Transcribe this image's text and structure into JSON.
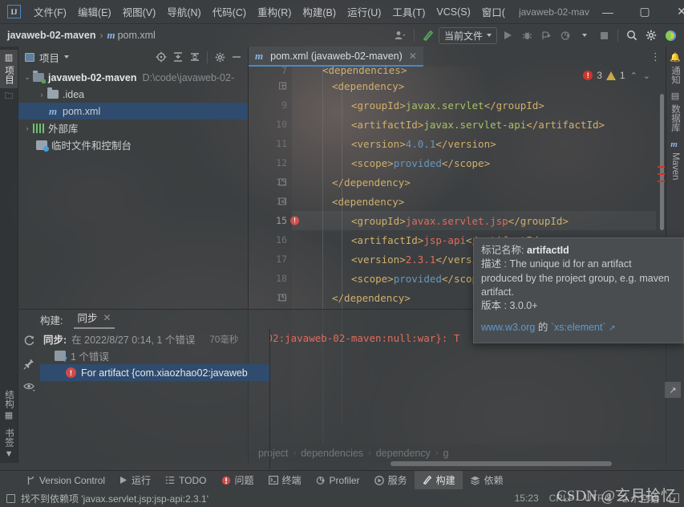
{
  "window": {
    "logo": "IJ",
    "title": "javaweb-02-mav",
    "minimize": "—",
    "maximize": "▢",
    "close": "✕"
  },
  "menu": [
    {
      "label": "文件(F)",
      "name": "menu-file"
    },
    {
      "label": "编辑(E)",
      "name": "menu-edit"
    },
    {
      "label": "视图(V)",
      "name": "menu-view"
    },
    {
      "label": "导航(N)",
      "name": "menu-navigate"
    },
    {
      "label": "代码(C)",
      "name": "menu-code"
    },
    {
      "label": "重构(R)",
      "name": "menu-refactor"
    },
    {
      "label": "构建(B)",
      "name": "menu-build"
    },
    {
      "label": "运行(U)",
      "name": "menu-run"
    },
    {
      "label": "工具(T)",
      "name": "menu-tools"
    },
    {
      "label": "VCS(S)",
      "name": "menu-vcs"
    },
    {
      "label": "窗口(",
      "name": "menu-window"
    }
  ],
  "navbar": {
    "project": "javaweb-02-maven",
    "separator": "›",
    "file_badge": "m",
    "file": "pom.xml",
    "run_config": "当前文件",
    "icons": {
      "profile": "profile-icon",
      "hammer": "build-hammer-icon",
      "run": "▶",
      "debug": "debug-icon",
      "run_coverage": "coverage-icon",
      "profiler": "profiler-icon",
      "stop": "■",
      "search": "search-icon",
      "settings": "gear-icon",
      "updates": "updates-icon"
    }
  },
  "left_strip": [
    {
      "label": "项目",
      "icon": "project-icon",
      "active": true,
      "name": "strip-project"
    },
    {
      "label": "",
      "icon": "folder-icon",
      "active": false,
      "name": "strip-commit"
    },
    {
      "label": "结构",
      "icon": "structure-icon",
      "active": false,
      "name": "strip-structure"
    },
    {
      "label": "书签",
      "icon": "bookmark-icon",
      "active": false,
      "name": "strip-bookmarks"
    }
  ],
  "right_strip": [
    {
      "label": "通知",
      "icon": "bell-icon",
      "name": "strip-notifications"
    },
    {
      "label": "数据库",
      "icon": "database-icon",
      "name": "strip-database"
    },
    {
      "label": "Maven",
      "icon": "maven-icon",
      "name": "strip-maven"
    }
  ],
  "project_panel": {
    "title": "项目",
    "dropdown_caret": "▾",
    "toolbar_icons": [
      "locate-icon",
      "expand-all-icon",
      "collapse-all-icon",
      "gear-icon",
      "hide-icon"
    ],
    "tree": [
      {
        "indent": 0,
        "twisty": "⌄",
        "icon": "module-folder-icon",
        "label": "javaweb-02-maven",
        "bold": true,
        "path": "D:\\code\\javaweb-02-",
        "selected": false
      },
      {
        "indent": 1,
        "twisty": "›",
        "icon": "folder-icon",
        "label": ".idea",
        "bold": false,
        "path": "",
        "selected": false
      },
      {
        "indent": 2,
        "twisty": "",
        "icon": "maven-file-icon",
        "label": "pom.xml",
        "bold": false,
        "path": "",
        "selected": true
      },
      {
        "indent": 0,
        "twisty": "›",
        "icon": "library-icon",
        "label": "外部库",
        "bold": false,
        "path": "",
        "selected": false
      },
      {
        "indent": 1,
        "twisty": "",
        "icon": "scratches-icon",
        "label": "临时文件和控制台",
        "bold": false,
        "path": "",
        "selected": false
      }
    ]
  },
  "editor": {
    "tab": {
      "badge": "m",
      "label": "pom.xml (javaweb-02-maven)",
      "close": "✕"
    },
    "overflow": "⋮",
    "inspections": {
      "error_count": "3",
      "error_glyph": "!",
      "warning_count": "1",
      "prev": "⌃",
      "next": "⌄"
    },
    "lines": [
      {
        "num": "7",
        "fold": "",
        "marker": "",
        "indent": 3,
        "tokens": [
          {
            "t": "tag",
            "v": "<dependencies>"
          }
        ],
        "current": false,
        "clipped": true
      },
      {
        "num": "8",
        "fold": "−",
        "marker": "",
        "indent": 4,
        "tokens": [
          {
            "t": "tag",
            "v": "<dependency>"
          }
        ],
        "current": false
      },
      {
        "num": "9",
        "fold": "",
        "marker": "",
        "indent": 6,
        "tokens": [
          {
            "t": "tag",
            "v": "<groupId>"
          },
          {
            "t": "val",
            "v": "javax.servlet"
          },
          {
            "t": "tag",
            "v": "</groupId>"
          }
        ],
        "current": false
      },
      {
        "num": "10",
        "fold": "",
        "marker": "",
        "indent": 6,
        "tokens": [
          {
            "t": "tag",
            "v": "<artifactId>"
          },
          {
            "t": "val",
            "v": "javax.servlet-api"
          },
          {
            "t": "tag",
            "v": "</artifactId>"
          }
        ],
        "current": false
      },
      {
        "num": "11",
        "fold": "",
        "marker": "",
        "indent": 6,
        "tokens": [
          {
            "t": "tag",
            "v": "<version>"
          },
          {
            "t": "num",
            "v": "4.0.1"
          },
          {
            "t": "tag",
            "v": "</version>"
          }
        ],
        "current": false
      },
      {
        "num": "12",
        "fold": "",
        "marker": "",
        "indent": 6,
        "tokens": [
          {
            "t": "tag",
            "v": "<scope>"
          },
          {
            "t": "num",
            "v": "provided"
          },
          {
            "t": "tag",
            "v": "</scope>"
          }
        ],
        "current": false
      },
      {
        "num": "13",
        "fold": "⌃",
        "marker": "",
        "indent": 4,
        "tokens": [
          {
            "t": "tag",
            "v": "</dependency>"
          }
        ],
        "current": false
      },
      {
        "num": "14",
        "fold": "−",
        "marker": "",
        "indent": 4,
        "tokens": [
          {
            "t": "tag",
            "v": "<dependency>"
          }
        ],
        "current": false
      },
      {
        "num": "15",
        "fold": "",
        "marker": "error",
        "indent": 6,
        "tokens": [
          {
            "t": "tag",
            "v": "<groupId>"
          },
          {
            "t": "err",
            "v": "javax.servlet.jsp"
          },
          {
            "t": "tag",
            "v": "</groupId>"
          }
        ],
        "current": true
      },
      {
        "num": "16",
        "fold": "",
        "marker": "",
        "indent": 6,
        "tokens": [
          {
            "t": "tag",
            "v": "<artifactId>"
          },
          {
            "t": "err",
            "v": "jsp-api"
          },
          {
            "t": "tag",
            "v": "</artifactId>"
          }
        ],
        "current": false
      },
      {
        "num": "17",
        "fold": "",
        "marker": "",
        "indent": 6,
        "tokens": [
          {
            "t": "tag",
            "v": "<version>"
          },
          {
            "t": "err",
            "v": "2.3.1"
          },
          {
            "t": "tag",
            "v": "</versi"
          }
        ],
        "current": false
      },
      {
        "num": "18",
        "fold": "",
        "marker": "",
        "indent": 6,
        "tokens": [
          {
            "t": "tag",
            "v": "<scope>"
          },
          {
            "t": "num",
            "v": "provided"
          },
          {
            "t": "tag",
            "v": "</scop"
          }
        ],
        "current": false
      },
      {
        "num": "19",
        "fold": "⌃",
        "marker": "",
        "indent": 4,
        "tokens": [
          {
            "t": "tag",
            "v": "</dependency>"
          }
        ],
        "current": false
      }
    ],
    "breadcrumbs": [
      "project",
      "dependencies",
      "dependency",
      "g"
    ],
    "breadcrumb_sep": "›"
  },
  "tooltip": {
    "name_label": "标记名称:",
    "name_value": "artifactId",
    "desc_label": "描述 :",
    "desc_value": "The unique id for an artifact",
    "desc_line2": "produced by the project group, e.g. maven",
    "desc_line3": "artifact.",
    "version_label": "版本 :",
    "version_value": "3.0.0+",
    "link_prefix": "www.w3.org",
    "link_mid": "的",
    "link_code": "`xs:element`",
    "link_arrow": "↗"
  },
  "build_panel": {
    "title": "构建:",
    "tab": "同步",
    "tab_close": "✕",
    "side_icons": [
      "refresh-icon",
      "pin-icon",
      "eye-icon"
    ],
    "rows": [
      {
        "icon": "none",
        "bold": "同步:",
        "text": "在 2022/8/27 0:14, 1 个错误",
        "time": "70毫秒",
        "selected": false,
        "indent": 0
      },
      {
        "icon": "question",
        "bold": "",
        "text": "1 个错误",
        "time": "",
        "selected": false,
        "indent": 0
      },
      {
        "icon": "error",
        "bold": "",
        "text": "For artifact {com.xiaozhao02:javaweb",
        "time": "",
        "selected": true,
        "indent": 1
      }
    ],
    "detail": "o02:javaweb-02-maven:null:war}: T",
    "side_button": "↗"
  },
  "tool_strip": [
    {
      "label": "Version Control",
      "icon": "branch-icon",
      "active": false,
      "name": "tool-version-control"
    },
    {
      "label": "运行",
      "icon": "run-icon",
      "active": false,
      "name": "tool-run"
    },
    {
      "label": "TODO",
      "icon": "list-icon",
      "active": false,
      "name": "tool-todo"
    },
    {
      "label": "问题",
      "icon": "error-icon",
      "active": false,
      "name": "tool-problems"
    },
    {
      "label": "终端",
      "icon": "terminal-icon",
      "active": false,
      "name": "tool-terminal"
    },
    {
      "label": "Profiler",
      "icon": "profiler-icon",
      "active": false,
      "name": "tool-profiler"
    },
    {
      "label": "服务",
      "icon": "services-icon",
      "active": false,
      "name": "tool-services"
    },
    {
      "label": "构建",
      "icon": "hammer-icon",
      "active": true,
      "name": "tool-build"
    },
    {
      "label": "依赖",
      "icon": "layers-icon",
      "active": false,
      "name": "tool-dependencies"
    }
  ],
  "statusbar": {
    "message": "找不到依赖项 'javax.servlet.jsp:jsp-api:2.3.1'",
    "time": "15:23",
    "line_sep": "CRLF",
    "encoding": "UTF-8",
    "indent": "2 个空格",
    "lock": "lock-icon"
  },
  "watermark": "CSDN @玄月拾忆",
  "colors": {
    "accent": "#4a88c7",
    "selection": "#2f4b6e",
    "error": "#d0342c",
    "warning": "#c8a84a",
    "tag": "#d0b06a",
    "value": "#a5c261",
    "error_text": "#e06c5b",
    "number": "#6897bb"
  }
}
